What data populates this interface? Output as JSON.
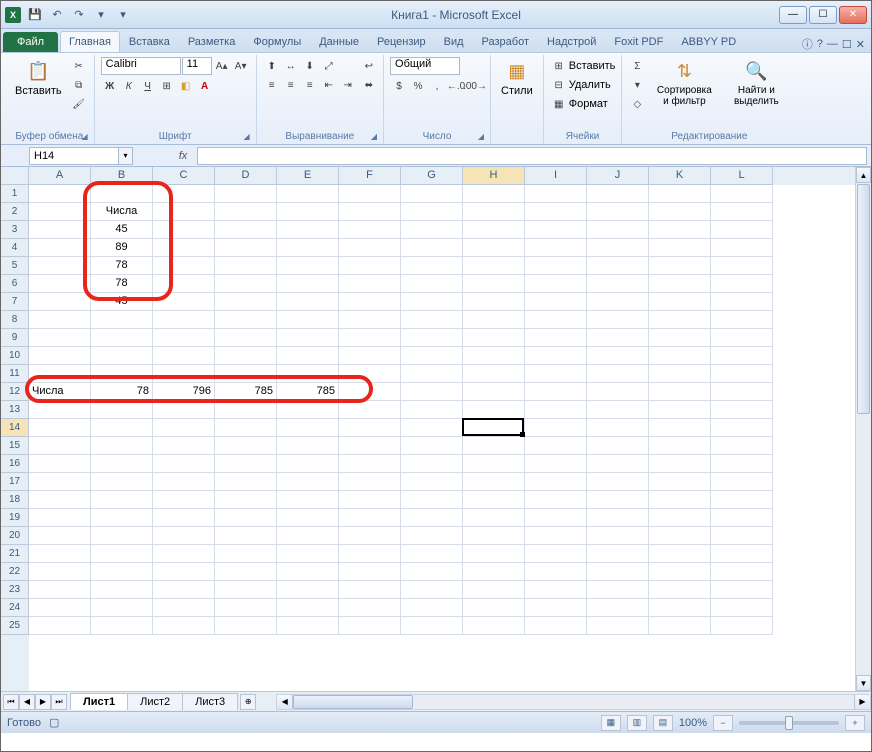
{
  "window": {
    "title": "Книга1 - Microsoft Excel",
    "app_icon_letter": "X"
  },
  "qat": {
    "save": "💾",
    "undo": "↶",
    "redo": "↷",
    "more1": "▾",
    "more2": "▾"
  },
  "win_controls": {
    "min": "—",
    "max": "☐",
    "close": "✕"
  },
  "tabs": {
    "file": "Файл",
    "items": [
      "Главная",
      "Вставка",
      "Разметка",
      "Формулы",
      "Данные",
      "Рецензир",
      "Вид",
      "Разработ",
      "Надстрой",
      "Foxit PDF",
      "ABBYY PD"
    ],
    "active_index": 0,
    "help": "?",
    "mdi_min": "—",
    "mdi_max": "☐",
    "mdi_close": "✕"
  },
  "ribbon": {
    "clipboard": {
      "paste_label": "Вставить",
      "cut": "✂",
      "copy": "⧉",
      "brush": "🖌",
      "group_label": "Буфер обмена"
    },
    "font": {
      "name": "Calibri",
      "size": "11",
      "bold": "Ж",
      "italic": "К",
      "underline": "Ч",
      "border": "⊞",
      "fill": "◧",
      "color": "A",
      "grow": "A▴",
      "shrink": "A▾",
      "group_label": "Шрифт"
    },
    "alignment": {
      "top": "⬆",
      "mid": "↔",
      "bot": "⬇",
      "left": "≡",
      "center": "≡",
      "right": "≡",
      "indent_dec": "⇤",
      "indent_inc": "⇥",
      "wrap": "↩",
      "merge": "⬌",
      "orient": "⤢",
      "group_label": "Выравнивание"
    },
    "number": {
      "format": "Общий",
      "currency": "$",
      "percent": "%",
      "comma": ",",
      "inc_dec": "←.0",
      "dec_dec": ".00→",
      "group_label": "Число"
    },
    "styles": {
      "label": "Стили",
      "icon": "▦",
      "group_label": ""
    },
    "cells": {
      "insert": "Вставить",
      "delete": "Удалить",
      "format": "Формат",
      "group_label": "Ячейки"
    },
    "editing": {
      "autosum": "Σ",
      "fill": "▾",
      "clear": "◇",
      "sort_label": "Сортировка и фильтр",
      "find_label": "Найти и выделить",
      "group_label": "Редактирование"
    }
  },
  "name_box": {
    "value": "H14"
  },
  "formula_bar": {
    "fx": "fx",
    "value": ""
  },
  "grid": {
    "columns": [
      "A",
      "B",
      "C",
      "D",
      "E",
      "F",
      "G",
      "H",
      "I",
      "J",
      "K",
      "L"
    ],
    "sel_col_index": 7,
    "sel_row": 14,
    "selected_cell": "H14",
    "row_count": 25,
    "data": {
      "B2": {
        "v": "Числа",
        "align": "tc"
      },
      "B3": {
        "v": "45",
        "align": "tc"
      },
      "B4": {
        "v": "89",
        "align": "tc"
      },
      "B5": {
        "v": "78",
        "align": "tc"
      },
      "B6": {
        "v": "78",
        "align": "tc"
      },
      "B7": {
        "v": "45",
        "align": "tc"
      },
      "A12": {
        "v": "Числа",
        "align": "tl"
      },
      "B12": {
        "v": "78"
      },
      "C12": {
        "v": "796"
      },
      "D12": {
        "v": "785"
      },
      "E12": {
        "v": "785"
      }
    }
  },
  "sheets": {
    "nav": {
      "first": "⏮",
      "prev": "◀",
      "next": "▶",
      "last": "⏭"
    },
    "items": [
      "Лист1",
      "Лист2",
      "Лист3"
    ],
    "new": "⊕",
    "active_index": 0
  },
  "status": {
    "ready": "Готово",
    "zoom": "100%",
    "zoom_minus": "−",
    "zoom_plus": "+"
  }
}
